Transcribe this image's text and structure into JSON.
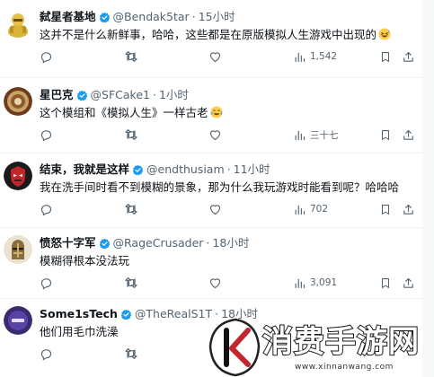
{
  "tweets": [
    {
      "name": "弑星者基地",
      "handle": "@Bendak5tar",
      "time": "15小时",
      "text": "这并不是什么新鲜事，哈哈，这些都是在原版模拟人生游戏中出现的",
      "emoji": "laughing-sweat-emoji",
      "views": "1,542",
      "avatar_color": "#d9b33a",
      "avatar_icon": "armored-knight-avatar"
    },
    {
      "name": "星巴克",
      "handle": "@SFCake1",
      "time": "1小时",
      "text": "这个模组和《模拟人生》一样古老",
      "emoji": "tears-of-joy-emoji",
      "views": "三十七",
      "avatar_color": "#c9a26a",
      "avatar_icon": "cake-avatar"
    },
    {
      "name": "结束，我就是这样",
      "handle": "@endthusiam",
      "time": "11小时",
      "text": "我在洗手间时看不到模糊的景象，那为什么我玩游戏时能看到呢？哈哈哈",
      "emoji": "",
      "views": "702",
      "avatar_color": "#c0262b",
      "avatar_icon": "red-mask-avatar"
    },
    {
      "name": "愤怒十字军",
      "handle": "@RageCrusader",
      "time": "18小时",
      "text": "模糊得根本没法玩",
      "emoji": "",
      "views": "3,091",
      "avatar_color": "#8a6e3c",
      "avatar_icon": "crusader-helmet-avatar"
    },
    {
      "name": "Some1sTech",
      "handle": "@TheRealS1T",
      "time": "18小时",
      "text": "他们用毛巾洗澡",
      "emoji": "",
      "views": "",
      "avatar_color": "#3a2a6e",
      "avatar_icon": "some1stech-logo-avatar"
    }
  ],
  "separator": "·",
  "verified_color": "#1d9bf0",
  "icon_color": "#536471",
  "watermark": {
    "title": "消费手游网",
    "url": "www.xinnanwang.com",
    "logo": "k-leaf-logo"
  }
}
